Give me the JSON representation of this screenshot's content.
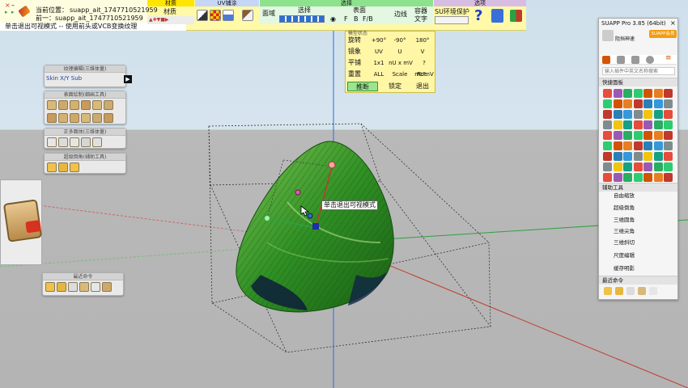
{
  "toolbar": {
    "sections": {
      "material": "材质",
      "uv_tile": "UV铺涂",
      "select": "选择",
      "options": "选项"
    },
    "small_labels": {
      "material": "材质",
      "face_domain": "面域",
      "select": "选择",
      "surface": "表面",
      "edge": "边线",
      "container": "容器",
      "text": "文字",
      "su_env_protect": "SU环境保护",
      "f": "F",
      "b": "B",
      "fb": "F/B"
    },
    "location_label": "当前位置：",
    "location_value": "suapp_ait_1747710521959",
    "previous_label": "前一：",
    "previous_value": "suapp_ait_1747710521959",
    "status_line": "单击退出可视模式 -- 使用前头或VCB变换纹理"
  },
  "mode_panel": {
    "title": "模型状态",
    "rows": [
      {
        "label": "旋转",
        "values": [
          "+90°",
          "-90°",
          "180°"
        ]
      },
      {
        "label": "镜象",
        "values": [
          "UV",
          "U",
          "V"
        ]
      },
      {
        "label": "平铺",
        "values": [
          "1x1",
          "nU x mV",
          "?mUmV"
        ]
      },
      {
        "label": "重置",
        "values": [
          "ALL",
          "Scale",
          "Rot."
        ]
      }
    ],
    "footer": [
      "推断",
      "锁定",
      "退出"
    ]
  },
  "left_panels": {
    "deform": {
      "title": "纹理编辑(三维体量)",
      "label": "Skin X/Y Sub"
    },
    "surface_draw": {
      "title": "表面绘制(细画工具)"
    },
    "ortho": {
      "title": "正多面体(三维体量)"
    },
    "cut": {
      "title": "超级倒角(辅助工具)"
    },
    "recent": {
      "title": "最近命令"
    }
  },
  "viewport": {
    "tooltip": "单击退出可视模式"
  },
  "suapp": {
    "title": "SUAPP Pro 3.85 (64bit)",
    "badge": "SUAPP会员",
    "user": "阻挡神速",
    "search_placeholder": "输入插件中英文名称搜索",
    "quick_panel": "快捷面板",
    "aux_tools": "辅助工具",
    "item_top": "自由缩放",
    "super_chamfer": "超级倒角",
    "sub_items": [
      "三维圆角",
      "三维尖角",
      "三维斜切"
    ],
    "ruler_tool": "尺度编辑",
    "shadow": "缓存明影",
    "recent_cmds": "最近命令"
  },
  "colors": {
    "toolbar_bg": "#fff9a8",
    "leaf_green": "#3f9a2a",
    "red_axis": "#c0392b",
    "green_axis": "#2ea043",
    "blue_axis": "#2c6fd6",
    "suapp_orange": "#f39c12"
  }
}
